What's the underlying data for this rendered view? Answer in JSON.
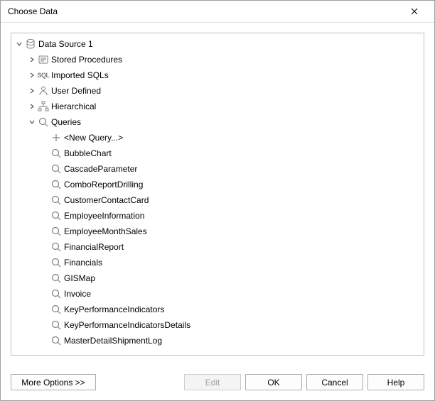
{
  "window": {
    "title": "Choose Data"
  },
  "tree": {
    "root": {
      "label": "Data Source 1",
      "expanded": true,
      "icon": "database",
      "children": [
        {
          "label": "Stored Procedures",
          "icon": "stored-proc",
          "expanded": false,
          "hasChildren": true
        },
        {
          "label": "Imported SQLs",
          "icon": "sql",
          "expanded": false,
          "hasChildren": true
        },
        {
          "label": "User Defined",
          "icon": "user-defined",
          "expanded": false,
          "hasChildren": true
        },
        {
          "label": "Hierarchical",
          "icon": "hierarchy",
          "expanded": false,
          "hasChildren": true
        },
        {
          "label": "Queries",
          "icon": "query",
          "expanded": true,
          "hasChildren": true,
          "children": [
            {
              "label": "<New Query...>",
              "icon": "plus"
            },
            {
              "label": "BubbleChart",
              "icon": "query"
            },
            {
              "label": "CascadeParameter",
              "icon": "query"
            },
            {
              "label": "ComboReportDrilling",
              "icon": "query"
            },
            {
              "label": "CustomerContactCard",
              "icon": "query"
            },
            {
              "label": "EmployeeInformation",
              "icon": "query"
            },
            {
              "label": "EmployeeMonthSales",
              "icon": "query"
            },
            {
              "label": "FinancialReport",
              "icon": "query"
            },
            {
              "label": "Financials",
              "icon": "query"
            },
            {
              "label": "GISMap",
              "icon": "query"
            },
            {
              "label": "Invoice",
              "icon": "query"
            },
            {
              "label": "KeyPerformanceIndicators",
              "icon": "query"
            },
            {
              "label": "KeyPerformanceIndicatorsDetails",
              "icon": "query"
            },
            {
              "label": "MasterDetailShipmentLog",
              "icon": "query"
            }
          ]
        }
      ]
    }
  },
  "buttons": {
    "more": "More Options >>",
    "edit": "Edit",
    "ok": "OK",
    "cancel": "Cancel",
    "help": "Help"
  },
  "edit_enabled": false
}
